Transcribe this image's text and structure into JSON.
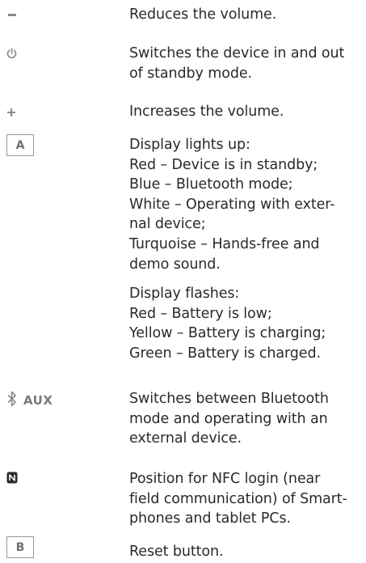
{
  "entries": [
    {
      "symbol": "",
      "icon": "minus-icon",
      "lines": [
        "Reduces the volume."
      ]
    },
    {
      "symbol": "",
      "icon": "power-icon",
      "lines": [
        "Switches the device in and out",
        "of standby mode."
      ]
    },
    {
      "symbol": "",
      "icon": "plus-icon",
      "lines": [
        "Increases the volume."
      ]
    },
    {
      "symbol": "A",
      "icon": "",
      "lines": [
        "Display lights up:",
        "Red – Device is in standby;",
        "Blue – Bluetooth mode;",
        "White – Operating with exter-",
        "nal device;",
        "Turquoise – Hands-free and",
        "demo sound."
      ],
      "lines2": [
        "Display flashes:",
        "Red – Battery is low;",
        "Yellow – Battery is charging;",
        "Green – Battery is charged."
      ]
    },
    {
      "symbol": "AUX",
      "icon": "bluetooth-icon",
      "lines": [
        "Switches between Bluetooth",
        "mode and operating with an",
        "external device."
      ]
    },
    {
      "symbol": "",
      "icon": "nfc-icon",
      "lines": [
        "Position for NFC login (near",
        "field communication) of Smart-",
        "phones and tablet PCs."
      ]
    },
    {
      "symbol": "B",
      "icon": "",
      "lines": [
        "Reset button."
      ]
    }
  ]
}
